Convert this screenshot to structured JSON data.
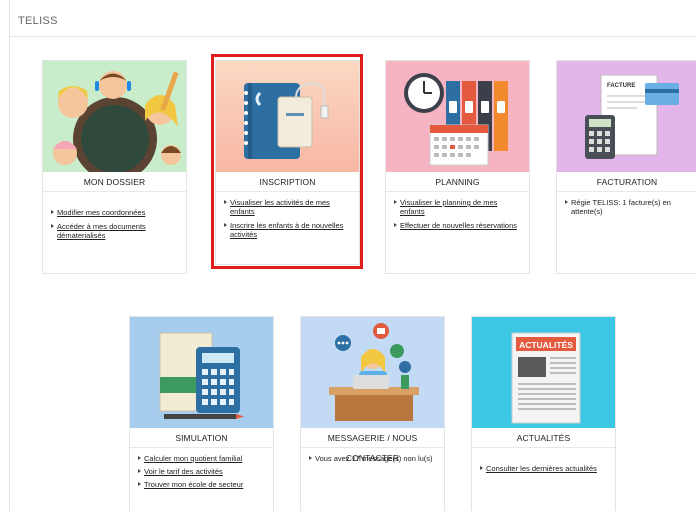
{
  "app": {
    "title": "TELISS"
  },
  "cards": [
    {
      "title": "MON DOSSIER",
      "items": [
        {
          "text": "Modifier mes coordonnées",
          "link": true
        },
        {
          "text": "Accéder à mes documents dématerialisés",
          "link": true
        }
      ]
    },
    {
      "title": "INSCRIPTION",
      "items": [
        {
          "text": "Visualiser les activités de mes enfants",
          "link": true
        },
        {
          "text": "Inscrire les enfants à de nouvelles activités",
          "link": true
        }
      ]
    },
    {
      "title": "PLANNING",
      "items": [
        {
          "text": "Visualiser le planning de mes enfants",
          "link": true
        },
        {
          "text": "Effectuer de nouvelles réservations",
          "link": true
        }
      ]
    },
    {
      "title": "FACTURATION",
      "items": [
        {
          "text": "Régie TELISS: 1 facture(s) en attente(s)",
          "link": false
        }
      ]
    },
    {
      "title": "SIMULATION",
      "items": [
        {
          "text": "Calculer mon quotient familial",
          "link": true
        },
        {
          "text": "Voir le tarif des activités",
          "link": true
        },
        {
          "text": "Trouver mon école de secteur",
          "link": true
        }
      ]
    },
    {
      "title": "MESSAGERIE / NOUS CONTACTER",
      "items": [
        {
          "text": "Vous avez 17 message(s) non lu(s)",
          "link": false
        }
      ]
    },
    {
      "title": "ACTUALITÉS",
      "items": [
        {
          "text": "Consulter les dernières actualités",
          "link": true
        }
      ]
    }
  ],
  "illustrations": {
    "facture_label": "FACTURE",
    "actualites_label": "ACTUALITÉS"
  },
  "colors": {
    "highlight": "#e01c1c",
    "mon_dossier_bg": "#c9eccb",
    "inscription_bg": "#f8c9b6",
    "planning_bg": "#f4a9bd",
    "facturation_bg": "#e4b5ea",
    "simulation_bg": "#a6cdee",
    "messagerie_bg": "#c2daf3",
    "actualites_bg": "#3cc7e4"
  }
}
